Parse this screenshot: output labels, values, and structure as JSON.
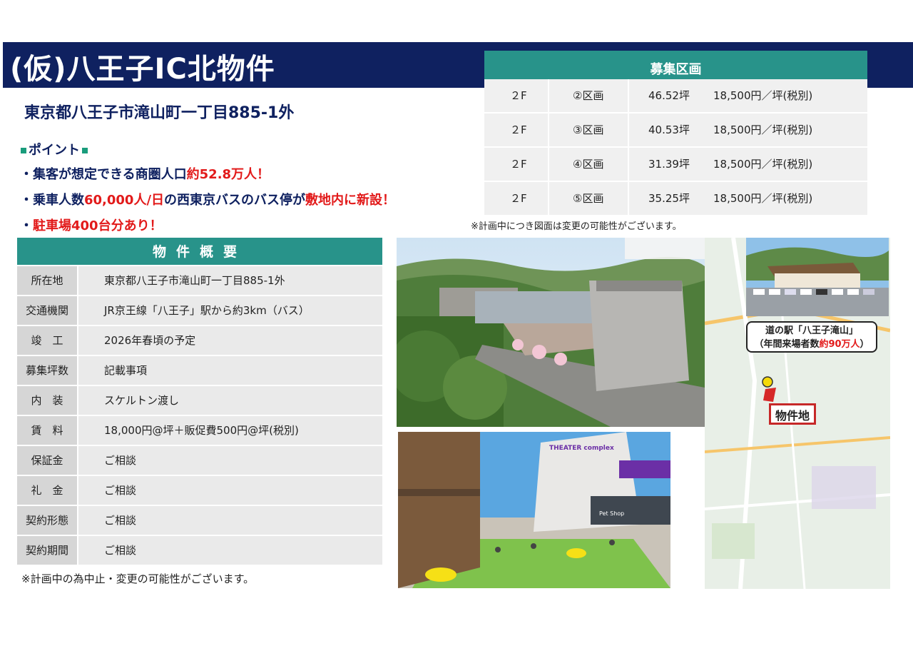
{
  "header": {
    "title": "(仮)八王子IC北物件",
    "address": "東京都八王子市滝山町一丁目885-1外"
  },
  "points": {
    "heading": "ポイント",
    "items": [
      {
        "prefix": "・集客が想定できる商圏人口",
        "highlight": "約52.8万人！",
        "suffix": ""
      },
      {
        "prefix": "・乗車人数",
        "highlight": "60,000人/日",
        "suffix": "の西東京バスのバス停が",
        "highlight2": "敷地内に新設！"
      },
      {
        "prefix": "・",
        "highlight": "駐車場400台分あり！",
        "suffix": ""
      }
    ]
  },
  "recruitment": {
    "heading": "募集区画",
    "rows": [
      {
        "floor": "２F",
        "section": "②区画",
        "area": "46.52坪",
        "price": "18,500円／坪(税別)"
      },
      {
        "floor": "２F",
        "section": "③区画",
        "area": "40.53坪",
        "price": "18,500円／坪(税別)"
      },
      {
        "floor": "２F",
        "section": "④区画",
        "area": "31.39坪",
        "price": "18,500円／坪(税別)"
      },
      {
        "floor": "２F",
        "section": "⑤区画",
        "area": "35.25坪",
        "price": "18,500円／坪(税別)"
      }
    ],
    "note": "※計画中につき図面は変更の可能性がございます。"
  },
  "overview": {
    "heading": "物件概要",
    "rows": [
      {
        "label": "所在地",
        "value": "東京都八王子市滝山町一丁目885-1外"
      },
      {
        "label": "交通機関",
        "value": "JR京王線「八王子」駅から約3km（バス）"
      },
      {
        "label": "竣　工",
        "value": "2026年春頃の予定"
      },
      {
        "label": "募集坪数",
        "value": "記載事項"
      },
      {
        "label": "内　装",
        "value": "スケルトン渡し"
      },
      {
        "label": "賃　料",
        "value": "18,000円@坪＋販促費500円@坪(税別)"
      },
      {
        "label": "保証金",
        "value": "ご相談"
      },
      {
        "label": "礼　金",
        "value": "ご相談"
      },
      {
        "label": "契約形態",
        "value": "ご相談"
      },
      {
        "label": "契約期間",
        "value": "ご相談"
      }
    ],
    "note": "※計画中の為中止・変更の可能性がございます。"
  },
  "map": {
    "callout_line1": "道の駅「八王子滝山」",
    "callout_line2_prefix": "（年間来場者数",
    "callout_line2_highlight": "約90万人",
    "callout_line2_suffix": "）",
    "site_label": "物件地"
  },
  "photos": {
    "theater_sign": "THEATER complex",
    "shop_sign": "Pet Shop"
  },
  "colors": {
    "navy": "#0f2160",
    "teal": "#28938a",
    "red": "#e21a1a",
    "map_site_border": "#c62828"
  }
}
